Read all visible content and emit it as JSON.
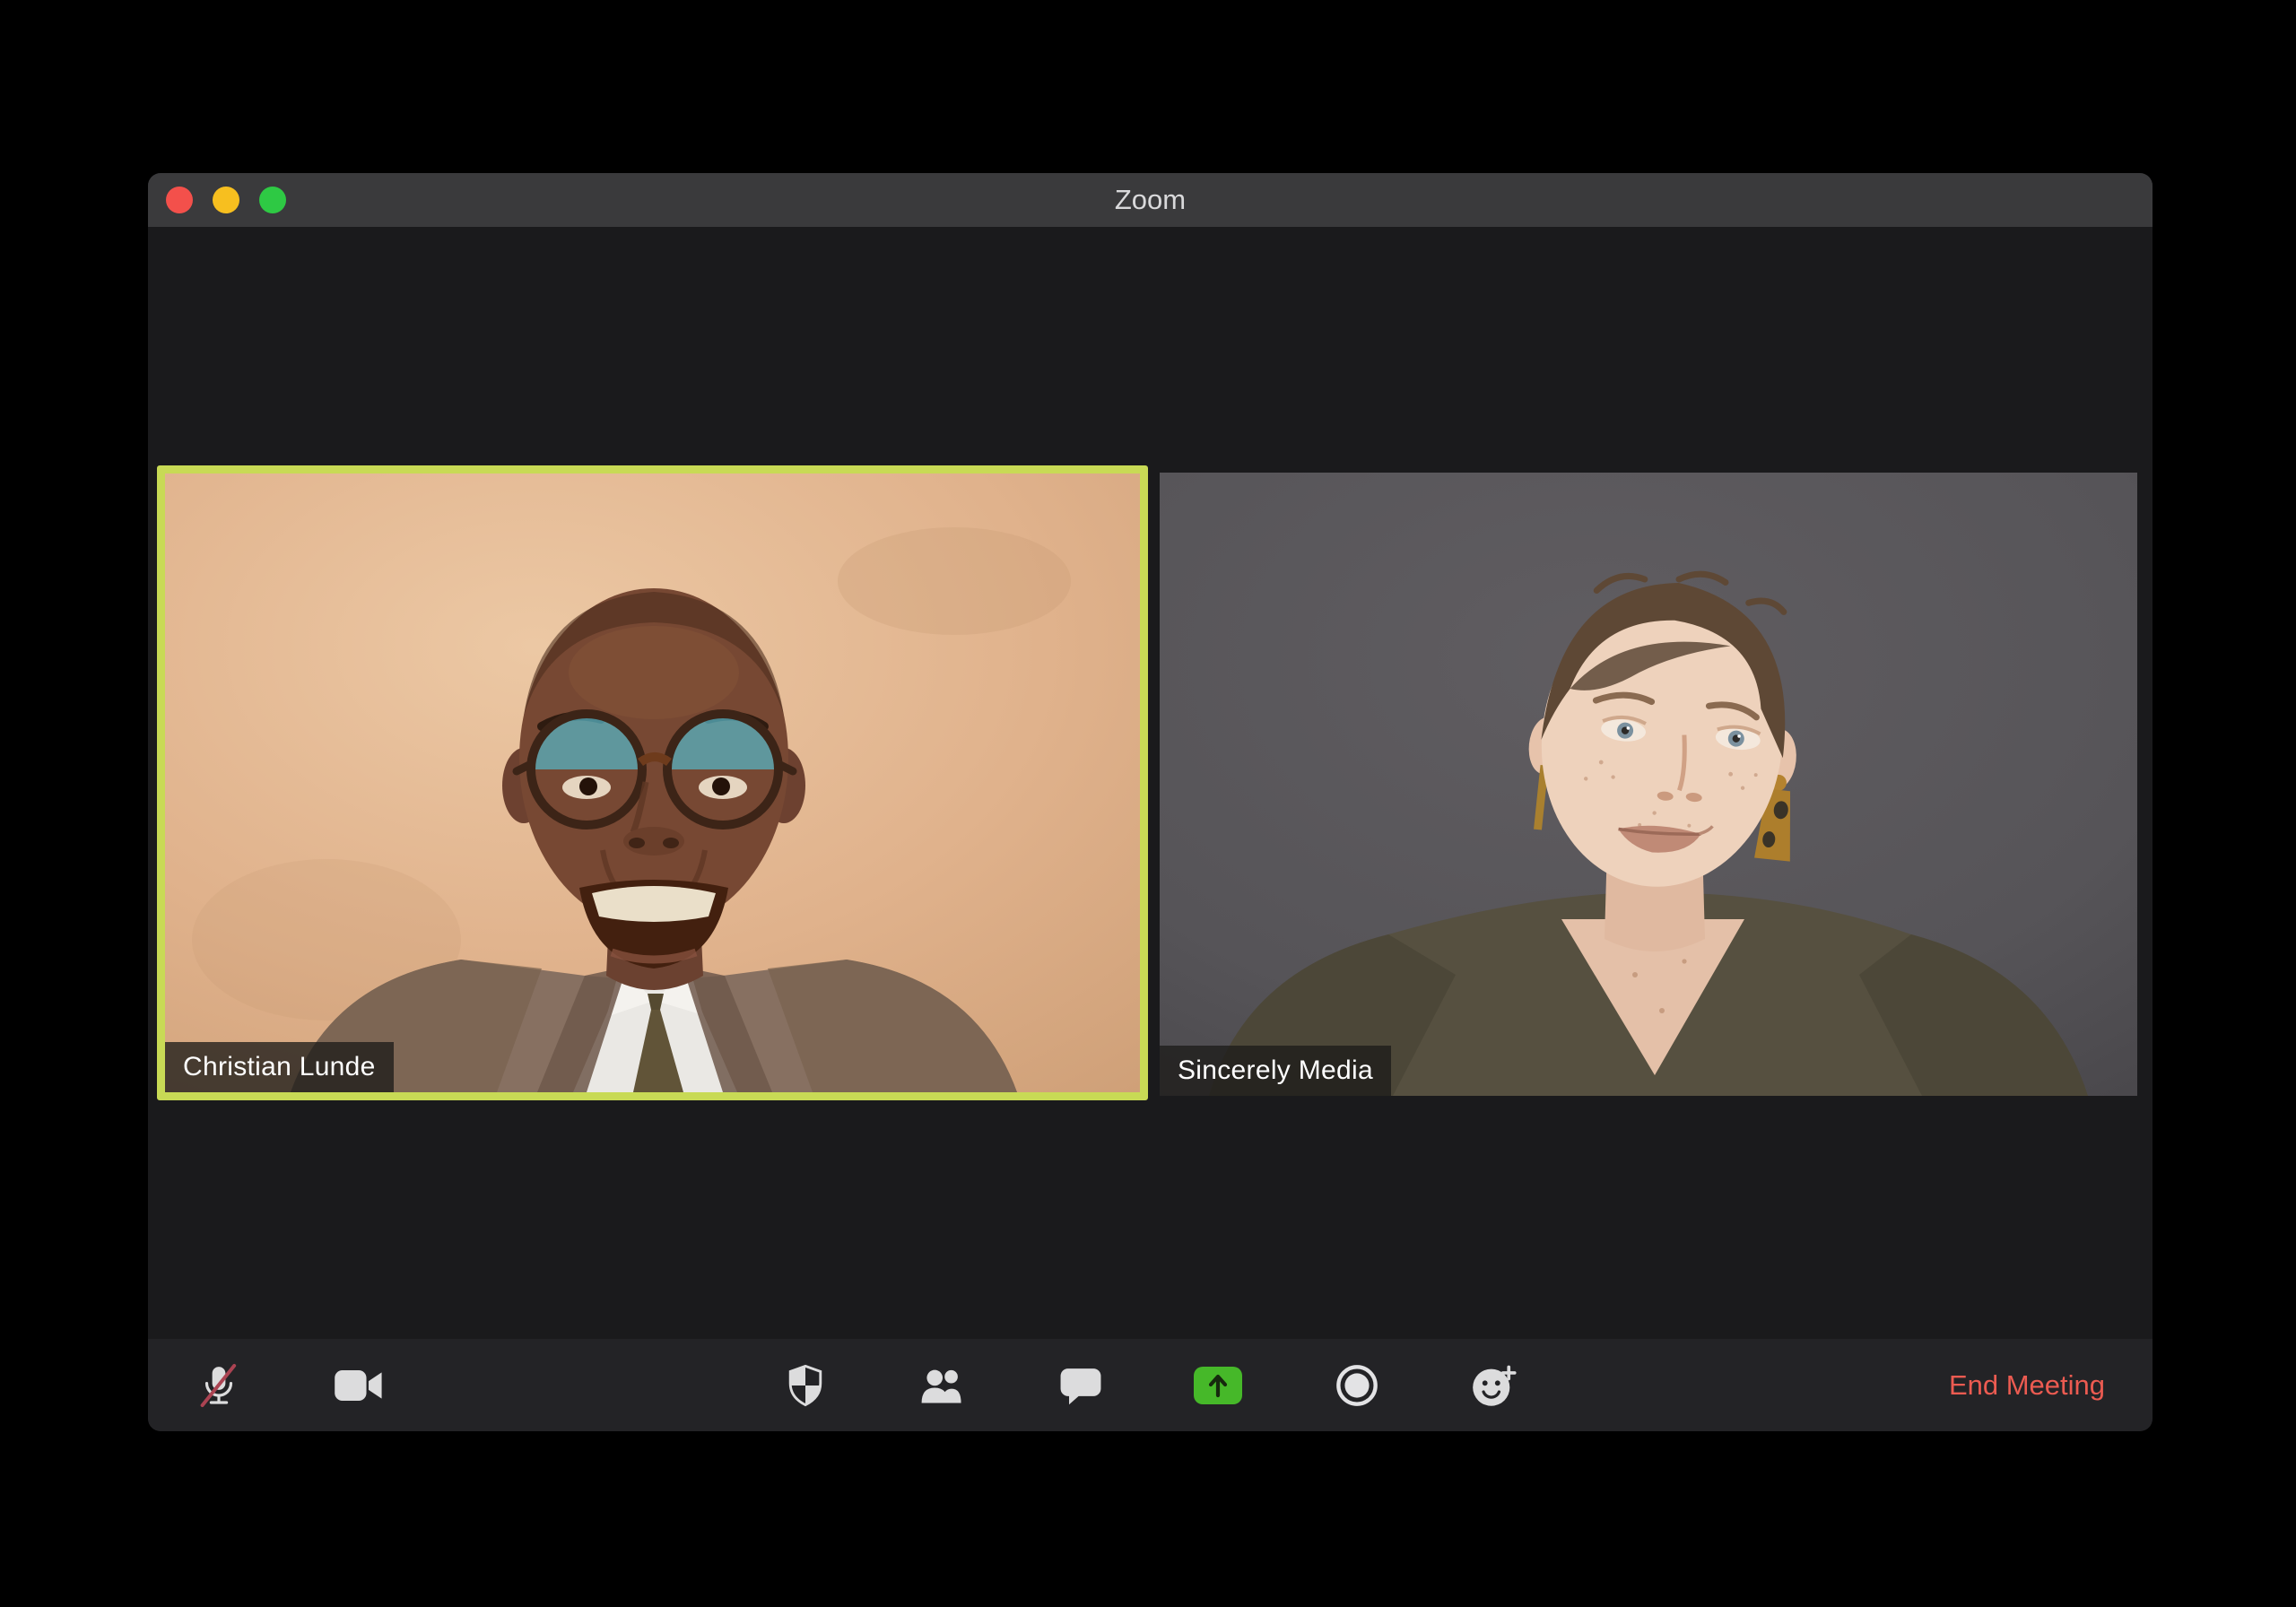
{
  "window": {
    "title": "Zoom",
    "traffic_lights": [
      {
        "name": "close",
        "color": "#f3504b"
      },
      {
        "name": "minimize",
        "color": "#f7bf1f"
      },
      {
        "name": "fullscreen",
        "color": "#2ec944"
      }
    ]
  },
  "participants": [
    {
      "name": "Christian Lunde",
      "active_speaker": true
    },
    {
      "name": "Sincerely Media",
      "active_speaker": false
    }
  ],
  "toolbar": {
    "buttons": [
      {
        "id": "mute",
        "icon": "microphone-muted-icon",
        "state": "muted"
      },
      {
        "id": "video",
        "icon": "video-camera-icon",
        "state": "on"
      },
      {
        "id": "security",
        "icon": "security-shield-icon"
      },
      {
        "id": "participants",
        "icon": "participants-icon"
      },
      {
        "id": "chat",
        "icon": "chat-bubble-icon"
      },
      {
        "id": "share-screen",
        "icon": "share-screen-arrow-icon"
      },
      {
        "id": "record",
        "icon": "record-circle-icon"
      },
      {
        "id": "reactions",
        "icon": "smiley-plus-icon"
      }
    ],
    "end_meeting_label": "End Meeting"
  },
  "colors": {
    "page_background": "#000000",
    "window_background": "#1a1a1c",
    "titlebar": "#3a3a3c",
    "toolbar": "#232326",
    "active_speaker_border": "#c8da55",
    "icon_gray": "#dcdcdd",
    "mute_slash_red": "#ab4352",
    "share_green": "#46b829",
    "end_meeting_red": "#ec5b51"
  }
}
